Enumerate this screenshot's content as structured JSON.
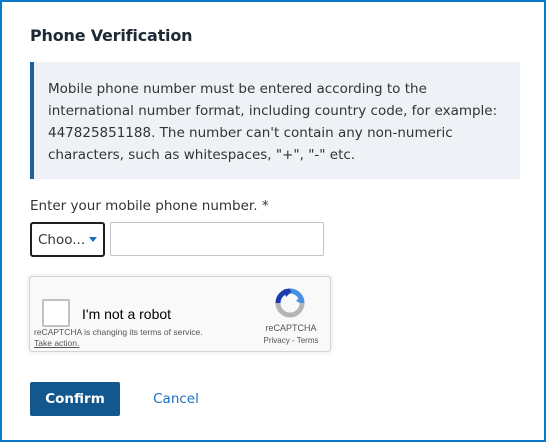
{
  "dialog": {
    "title": "Phone Verification",
    "info_text": "Mobile phone number must be entered according to the international number format, including country code, for example: 447825851188. The number can't contain any non-numeric characters, such as whitespaces, \"+\", \"-\" etc."
  },
  "form": {
    "phone_label": "Enter your mobile phone number. *",
    "country_select_value": "Choo...",
    "phone_input_value": ""
  },
  "recaptcha": {
    "checkbox_label": "I'm not a robot",
    "terms_note": "reCAPTCHA is changing its terms of service.",
    "take_action": "Take action.",
    "brand": "reCAPTCHA",
    "privacy": "Privacy",
    "separator": " - ",
    "terms": "Terms"
  },
  "actions": {
    "confirm_label": "Confirm",
    "cancel_label": "Cancel"
  },
  "colors": {
    "frame_border": "#0a78c8",
    "primary_button": "#12588f",
    "link": "#1a6fc0",
    "info_bg": "#eef2f6",
    "info_accent": "#1a5f9e"
  }
}
